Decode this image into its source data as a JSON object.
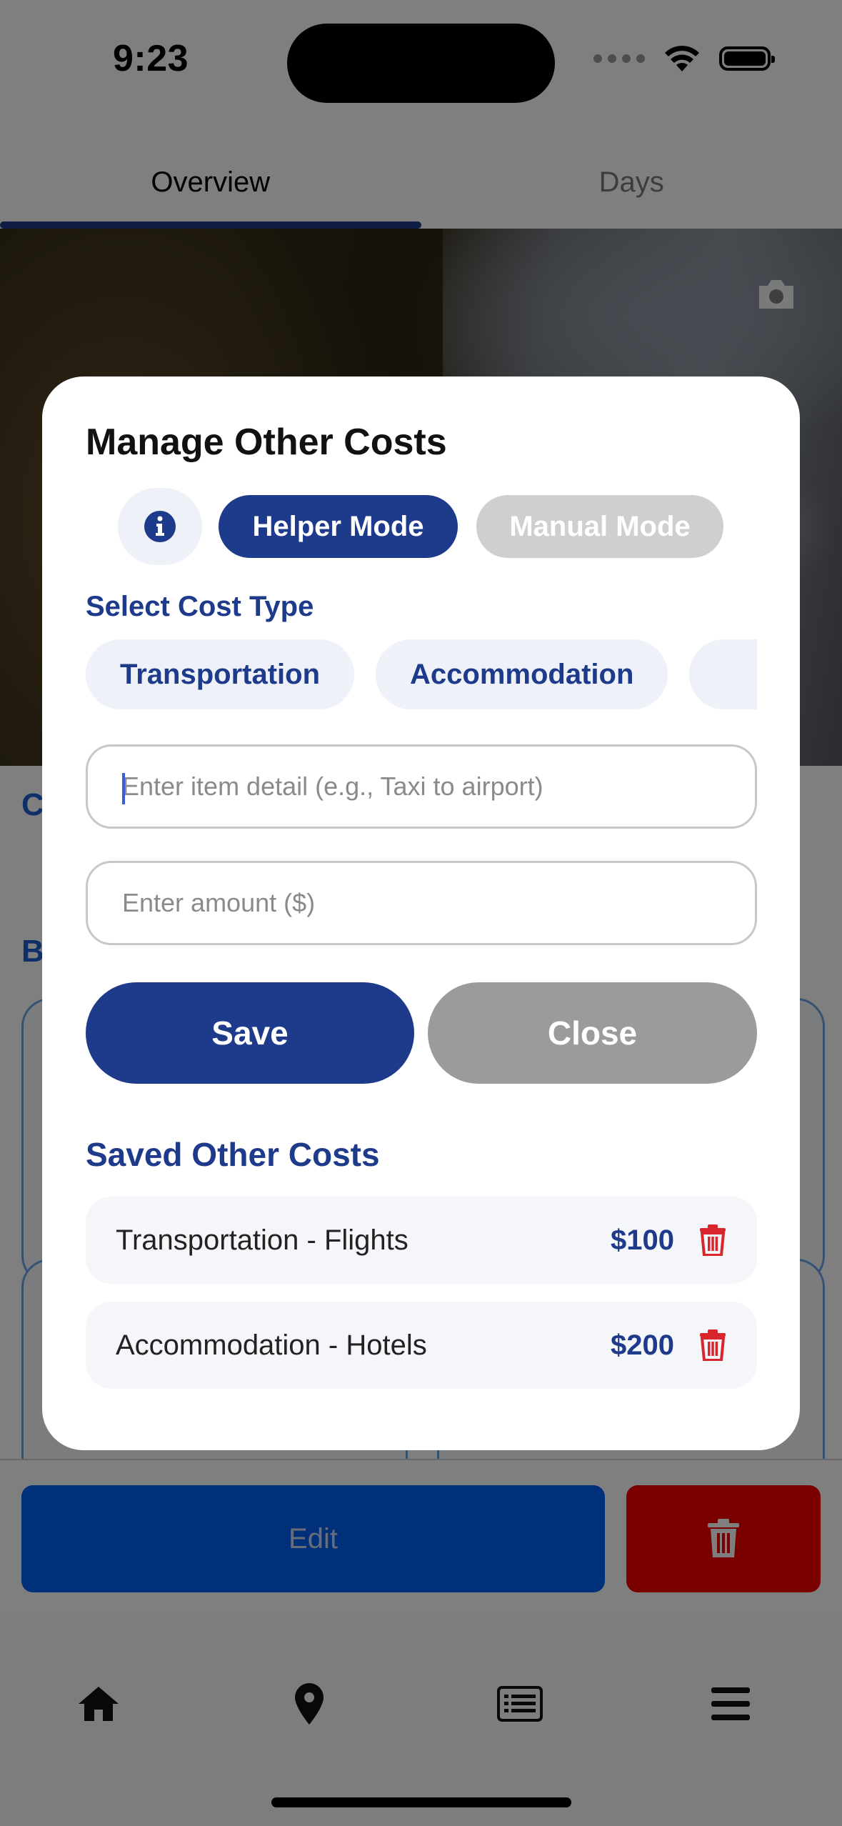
{
  "status_bar": {
    "time": "9:23"
  },
  "top_tabs": [
    {
      "label": "Overview",
      "active": true
    },
    {
      "label": "Days",
      "active": false
    }
  ],
  "page": {
    "partial_heading_1": "C",
    "partial_heading_2": "B"
  },
  "action_bar": {
    "edit_label": "Edit"
  },
  "bottom_nav": [
    "home-icon",
    "map-pin-icon",
    "list-icon",
    "menu-icon"
  ],
  "modal": {
    "title": "Manage Other Costs",
    "mode_buttons": {
      "helper": "Helper Mode",
      "manual": "Manual Mode"
    },
    "select_label": "Select Cost Type",
    "cost_types": [
      "Transportation",
      "Accommodation",
      ""
    ],
    "item_detail_placeholder": "Enter item detail (e.g., Taxi to airport)",
    "amount_placeholder": "Enter amount ($)",
    "save_label": "Save",
    "close_label": "Close",
    "saved_title": "Saved Other Costs",
    "saved_items": [
      {
        "name": "Transportation - Flights",
        "amount": "$100"
      },
      {
        "name": "Accommodation - Hotels",
        "amount": "$200"
      }
    ]
  },
  "colors": {
    "primary": "#1e3a8a",
    "edit_blue": "#0160f2",
    "delete_red": "#f40000",
    "trash_red": "#d8262c",
    "neutral_gray": "#9b9b9b"
  }
}
